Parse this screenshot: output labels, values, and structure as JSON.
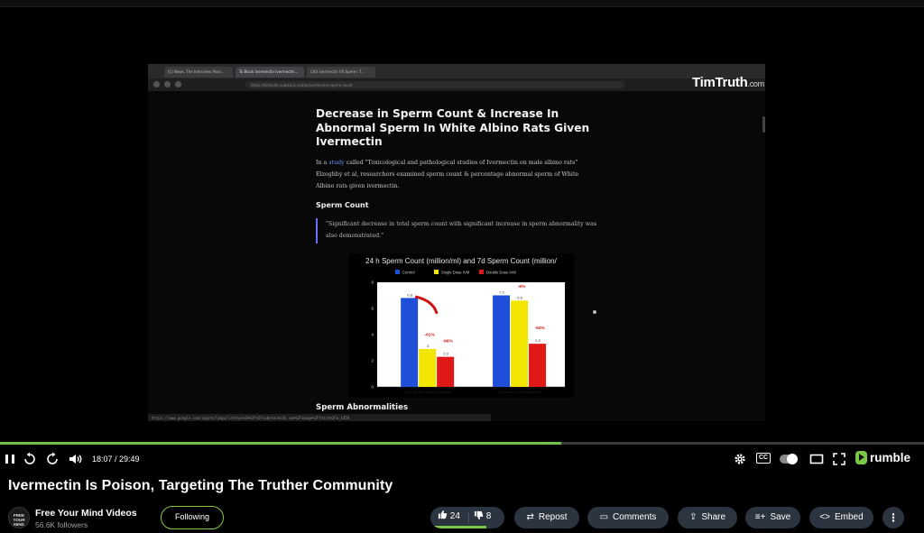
{
  "recording": {
    "tabs": [
      {
        "label": "(1) News. The Interview: Pass..."
      },
      {
        "label": "To Block Ivermectin Ivermectin..."
      },
      {
        "label": "(30) Ivermectin VS Sperm: T..."
      }
    ],
    "url": "https://timtruth.substack.com/p/ivermectin-sperm-count",
    "status_url": "https://www.google.com/imgres?imgurl=https%3A%2F%2Fsubstackcdn.com%2Fimage%2Ffetch%2Fw_1456",
    "watermark": "TimTruth",
    "watermark_suffix": ".com",
    "article": {
      "title": "Decrease in Sperm Count & Increase In Abnormal Sperm In White Albino Rats Given Ivermectin",
      "intro_before_link": "In a ",
      "intro_link": "study",
      "intro_after_link": " called \"Toxicological and pathological studies of Ivermectin on male albino rats\" Elzoghby et al, researchers examined sperm count & percentage abnormal sperm of White Albino rats given ivermectin.",
      "heading": "Sperm Count",
      "quote": "\"Significant decrease in total sperm count with significant increase in sperm abnormality was also demonstrated.\"",
      "heading2": "Sperm Abnormalities"
    }
  },
  "chart_data": {
    "type": "bar",
    "title": "24 h Sperm Count (million/ml) and 7d Sperm Count (million/",
    "legend_position": "top",
    "categories": [
      "24 h Sperm Count (million/ml)",
      "7d Sperm Count (million/ml)"
    ],
    "series": [
      {
        "name": "Control",
        "color": "#1f4fd8",
        "values": [
          6.8,
          7.0
        ]
      },
      {
        "name": "Single Dose IVM",
        "color": "#f2e600",
        "values": [
          2.9,
          6.6
        ]
      },
      {
        "name": "Double Dose IVM",
        "color": "#e01818",
        "values": [
          2.3,
          3.3
        ]
      }
    ],
    "ylim": [
      0,
      8
    ],
    "yticks": [
      "0",
      "2",
      "4",
      "6",
      "8"
    ],
    "data_labels": [
      "6.8",
      "3",
      "2.3",
      "7.0",
      "6.6",
      "3.3"
    ],
    "annotations": [
      "-61%",
      "-66%",
      "-6%",
      "-52%"
    ],
    "grid": false
  },
  "player": {
    "time": "18:07 / 29:49",
    "progress": 0.607,
    "brand": "rumble"
  },
  "video": {
    "title": "Ivermectin Is Poison, Targeting The Truther Community"
  },
  "channel": {
    "avatar_text": "FREE YOUR MIND",
    "name": "Free Your Mind Videos",
    "followers": "56.6K followers",
    "follow_label": "Following"
  },
  "actions": {
    "likes": "24",
    "dislikes": "8",
    "like_ratio": 0.75,
    "repost": "Repost",
    "comments": "Comments",
    "share": "Share",
    "save": "Save",
    "embed": "Embed"
  },
  "colors": {
    "accent": "#85c742",
    "button_bg": "#2c3440"
  }
}
